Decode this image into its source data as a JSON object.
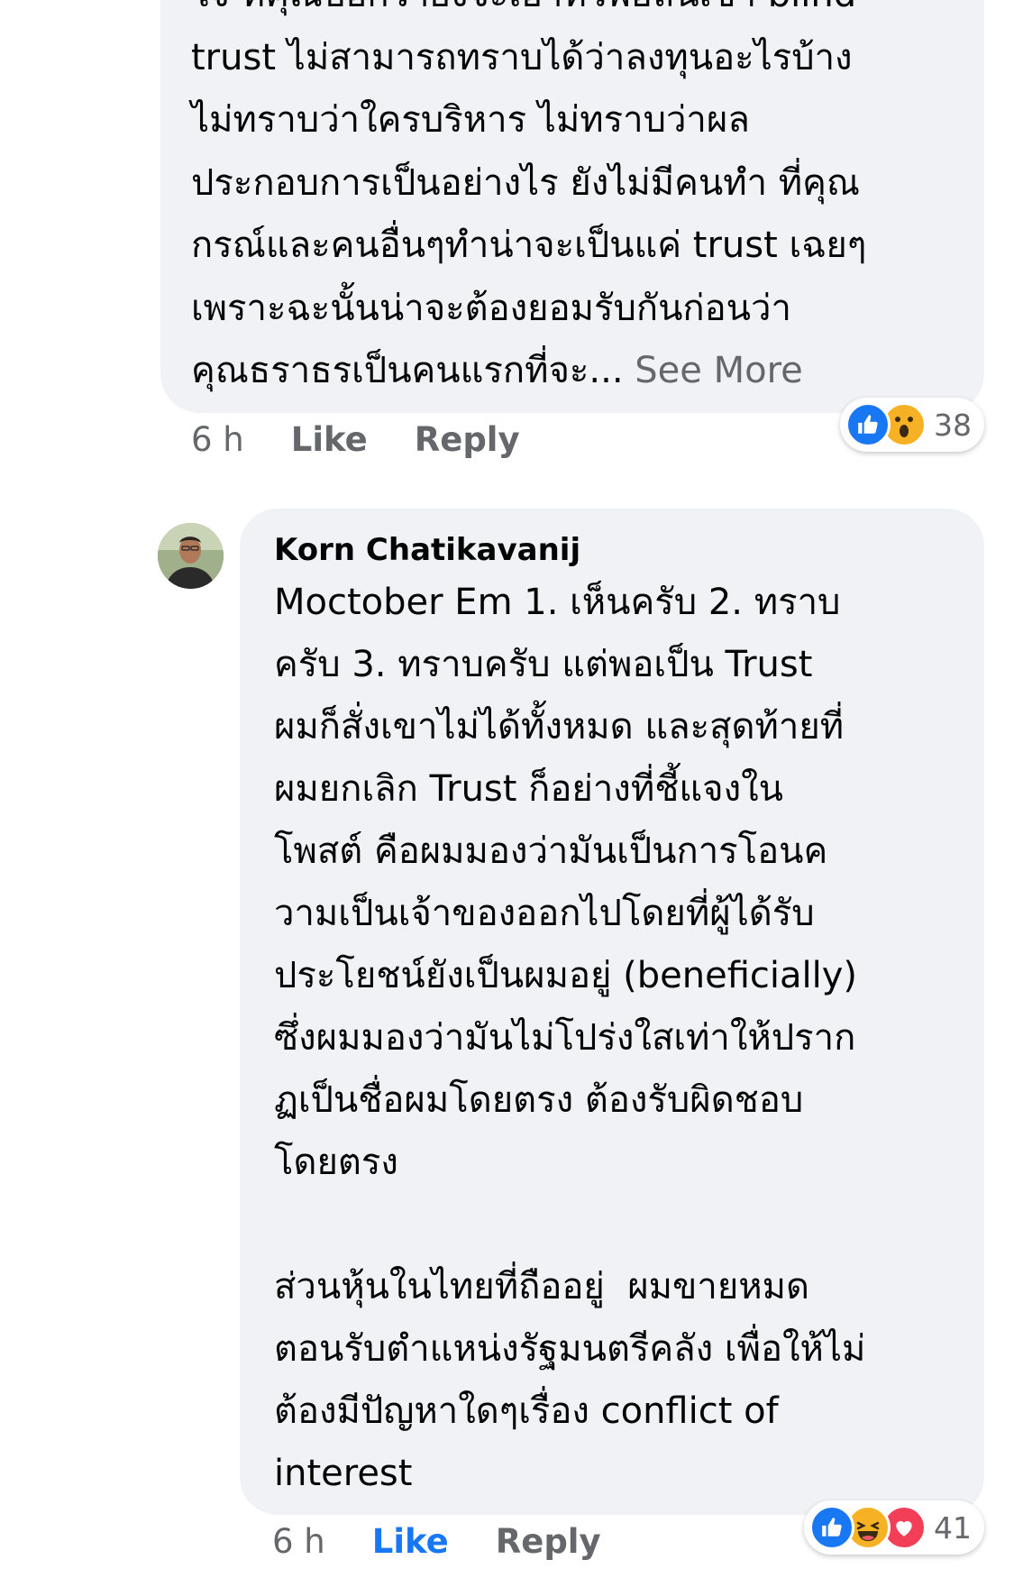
{
  "comments": [
    {
      "text_lines": [
        "ใจ ที่คุณบอกว่ายังจะเอาทั่วพอลินเข้า blind",
        "trust ไม่สามารถทราบได้ว่าลงทุนอะไรบ้าง",
        "ไม่ทราบว่าใครบริหาร ไม่ทราบว่าผล",
        "ประกอบการเป็นอย่างไร ยังไม่มีคนทำ ที่คุณ",
        "กรณ์และคนอื่นๆทำน่าจะเป็นแค่ trust เฉยๆ",
        "เพราะฉะนั้นน่าจะต้องยอมรับกันก่อนว่า",
        "คุณธราธรเป็นคนแรกที่จะ..."
      ],
      "see_more": "See More",
      "time": "6 h",
      "like_label": "Like",
      "reply_label": "Reply",
      "reactions": [
        "like-icon",
        "wow-icon"
      ],
      "reaction_count": "38"
    },
    {
      "author": "Korn Chatikavanij",
      "text_lines": [
        "Moctober Em 1. เห็นครับ 2. ทราบ",
        "ครับ 3. ทราบครับ แต่พอเป็น Trust",
        "ผมก็สั่งเขาไม่ได้ทั้งหมด และสุดท้ายที่",
        "ผมยกเลิก Trust ก็อย่างที่ชี้แจงใน",
        "โพสต์ คือผมมองว่ามันเป็นการโอนค",
        "วามเป็นเจ้าของออกไปโดยที่ผู้ได้รับ",
        "ประโยชน์ยังเป็นผมอยู่ (beneficially)",
        "ซึ่งผมมองว่ามันไม่โปร่งใสเท่าให้ปราก",
        "ฏเป็นชื่อผมโดยตรง ต้องรับผิดชอบ",
        "โดยตรง",
        "",
        "ส่วนหุ้นในไทยที่ถืออยู่  ผมขายหมด",
        "ตอนรับตำแหน่งรัฐมนตรีคลัง เพื่อให้ไม่",
        "ต้องมีปัญหาใดๆเรื่อง conflict of",
        "interest"
      ],
      "time": "6 h",
      "like_label": "Like",
      "reply_label": "Reply",
      "reactions": [
        "like-icon",
        "haha-icon",
        "love-icon"
      ],
      "reaction_count": "41"
    }
  ],
  "colors": {
    "bubble": "#f0f2f5",
    "meta": "#65676b",
    "like_active": "#1877f2",
    "love": "#f33e58",
    "emoji_yellow": "#f7b125"
  }
}
